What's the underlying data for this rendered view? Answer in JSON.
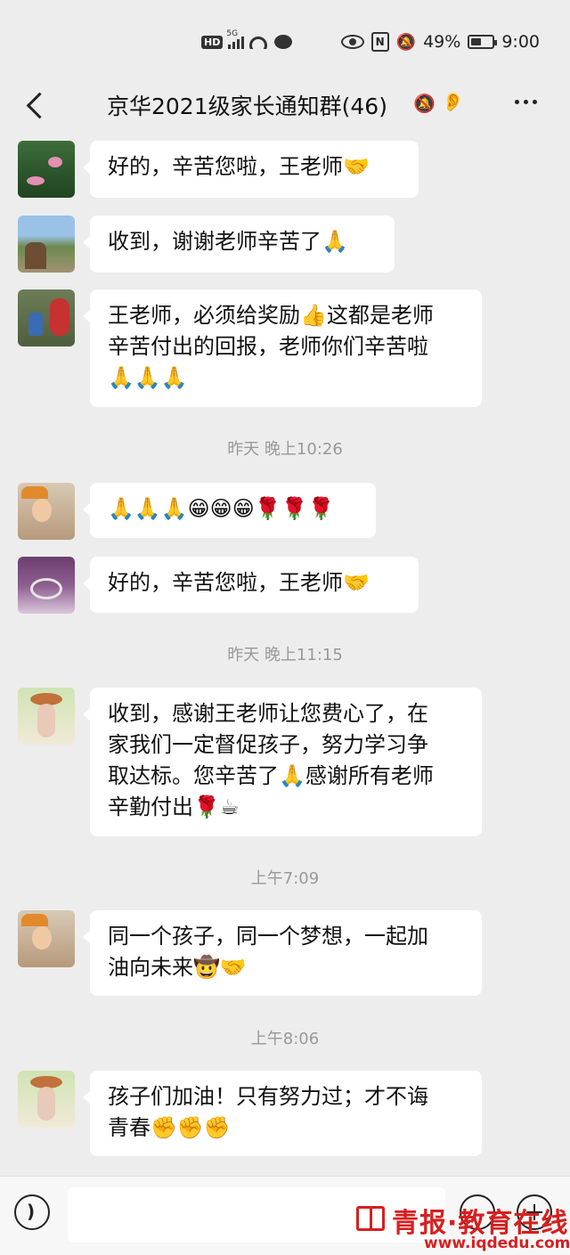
{
  "status_bar": {
    "network": "5G",
    "badge": "HD",
    "battery": "49%",
    "battery_level": 0.49,
    "time": "9:00"
  },
  "header": {
    "title": "京华2021级家长通知群(46)",
    "icons": [
      "back-icon",
      "mute-icon",
      "ear-icon",
      "more-icon"
    ]
  },
  "messages": [
    {
      "kind": "message",
      "avatar": "lotus-avatar",
      "text": "好的，辛苦您啦，王老师🤝"
    },
    {
      "kind": "message",
      "avatar": "outdoor-avatar",
      "text": "收到，谢谢老师辛苦了🙏"
    },
    {
      "kind": "message",
      "avatar": "minnie-avatar",
      "text": "王老师，必须给奖励👍这都是老师\n辛苦付出的回报，老师你们辛苦啦\n🙏🙏🙏"
    },
    {
      "kind": "time",
      "text": "昨天 晚上10:26"
    },
    {
      "kind": "message",
      "avatar": "family-avatar",
      "text": "🙏🙏🙏😁😁😁🌹🌹🌹"
    },
    {
      "kind": "message",
      "avatar": "ring-avatar",
      "text": "好的，辛苦您啦，王老师🤝"
    },
    {
      "kind": "time",
      "text": "昨天 晚上11:15"
    },
    {
      "kind": "message",
      "avatar": "girl-avatar",
      "text": "收到，感谢王老师让您费心了，在\n家我们一定督促孩子，努力学习争\n取达标。您辛苦了🙏感谢所有老师\n辛勤付出🌹☕"
    },
    {
      "kind": "time",
      "text": "上午7:09"
    },
    {
      "kind": "message",
      "avatar": "family-avatar",
      "text": "同一个孩子，同一个梦想，一起加\n油向未来🤠🤝"
    },
    {
      "kind": "time",
      "text": "上午8:06"
    },
    {
      "kind": "message",
      "avatar": "girl-avatar",
      "text": "孩子们加油！只有努力过；才不诲\n青春✊✊✊"
    }
  ],
  "input_bar": {
    "icons": [
      "voice-icon",
      "emoji-icon",
      "plus-icon"
    ],
    "input_value": ""
  },
  "watermark": {
    "brand": "青报·教育在线",
    "url": "www.iqdedu.com"
  },
  "colors": {
    "background": "#ededed",
    "bubble": "#ffffff",
    "timestamp": "#999999",
    "watermark": "#d62020"
  }
}
